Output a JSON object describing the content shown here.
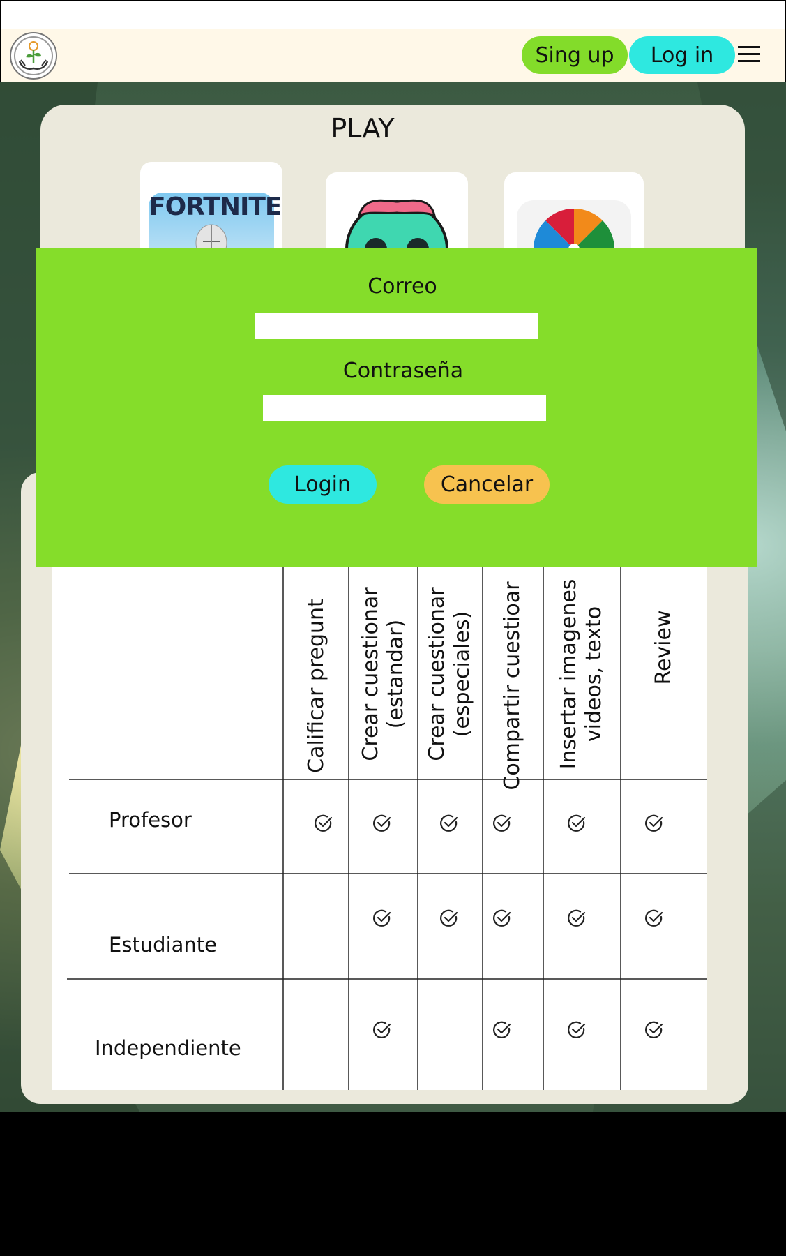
{
  "header": {
    "signup_label": "Sing up",
    "login_label": "Log in",
    "logo_icon": "sprout-in-hands-logo-icon",
    "menu_icon": "hamburger-menu-icon"
  },
  "play": {
    "title": "PLAY",
    "games": [
      {
        "name": "FORTNITE",
        "icon": "fortnite-game-icon"
      },
      {
        "name": "",
        "icon": "zombie-game-icon"
      },
      {
        "name": "",
        "icon": "prize-wheel-game-icon"
      }
    ]
  },
  "modal": {
    "email_label": "Correo",
    "email_value": "",
    "password_label": "Contraseña",
    "password_value": "",
    "login_button": "Login",
    "cancel_button": "Cancelar"
  },
  "table": {
    "columns": [
      "Calificar pregunt",
      "Crear cuestionar\n(estandar)",
      "Crear cuestionar\n(especiales)",
      "Compartir cuestioar",
      "Insertar imagenes\nvideos, texto",
      "Review"
    ],
    "rows": [
      {
        "label": "Profesor",
        "checks": [
          true,
          true,
          true,
          true,
          true,
          true
        ]
      },
      {
        "label": "Estudiante",
        "checks": [
          false,
          true,
          true,
          true,
          true,
          true
        ]
      },
      {
        "label": "Independiente",
        "checks": [
          false,
          true,
          false,
          true,
          true,
          true
        ]
      }
    ],
    "check_icon": "check-circle-icon"
  },
  "colors": {
    "signup": "#83dc2a",
    "login": "#2ee8e0",
    "modal": "#85dd2a",
    "cancel": "#f7c24f",
    "header": "#fff8e8"
  }
}
